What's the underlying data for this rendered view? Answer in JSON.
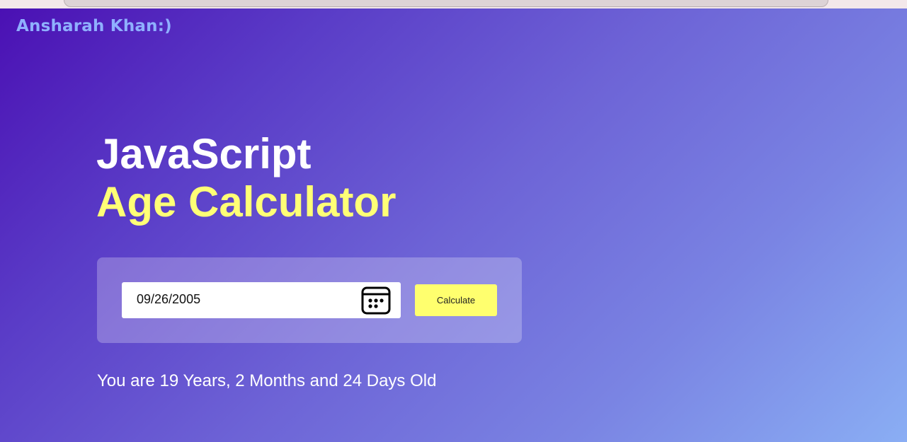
{
  "brand": {
    "text": "Ansharah Khan:)"
  },
  "hero": {
    "title_line1": "JavaScript",
    "title_line2": "Age Calculator"
  },
  "form": {
    "date_value": "09/26/2005",
    "calendar_icon": "calendar-icon",
    "calculate_label": "Calculate"
  },
  "result": {
    "text": "You are 19 Years, 2 Months and 24 Days Old"
  },
  "colors": {
    "accent_yellow": "#ffff6e",
    "brand_blue": "#8fb0ff",
    "text_white": "#ffffff"
  }
}
